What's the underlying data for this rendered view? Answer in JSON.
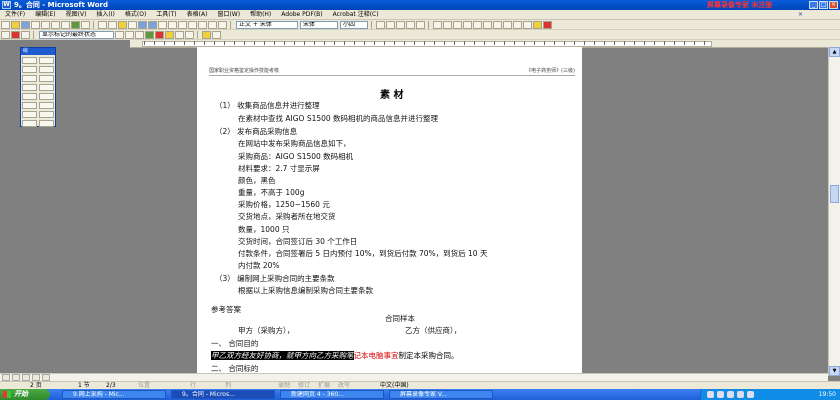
{
  "window": {
    "title": "9。合同 - Microsoft Word",
    "watermark": "屏幕录像专家 未注册"
  },
  "menu": {
    "items": [
      "文件(F)",
      "编辑(E)",
      "视图(V)",
      "插入(I)",
      "格式(O)",
      "工具(T)",
      "表格(A)",
      "窗口(W)",
      "帮助(H)",
      "Adobe PDF(B)",
      "Acrobat 注释(C)"
    ]
  },
  "toolbar": {
    "style": "正文 + 宋体",
    "font": "宋体",
    "size": "小四",
    "markup": "显示标记的最终状态",
    "colors": {
      "highlight": "#ffff00",
      "font_color": "#ff0000"
    }
  },
  "palette": {
    "title": "绘"
  },
  "document": {
    "header_left": "国家职业资格鉴定操作技能考核",
    "header_right": "《电子商务师》(三级)",
    "title": "素  材",
    "lines": [
      "（1）    收集商品信息并进行整理",
      "在素材中查找 AIGO S1500 数码相机的商品信息并进行整理",
      "（2）    发布商品采购信息",
      "在网站中发布采购商品信息如下，",
      "采购商品：AIGO S1500 数码相机",
      "材料要求：2.7 寸显示屏",
      "颜色，黑色",
      "重量，不高于   100g",
      "采购价格，1250~1560 元",
      "交货地点，采购者所在地交货",
      "数量，1000 只",
      "交货时间，合同签订后 30 个工作日",
      "付款条件，合同签署后 5 日内预付 10%，到货后付款 70%，到货后 10 天",
      "内付款 20%",
      "（3）    编制网上采购合同的主要条款",
      "根据以上采购信息编制采购合同主要条款",
      "参考答案",
      "合同样本",
      "甲方（采购方），",
      "乙方（供应商），",
      "一、     合同目的",
      "二、     合同标的"
    ],
    "selected_text": "甲乙双方经友好协商，就甲方向乙方采购笔",
    "red_text": "记本电脑事宜",
    "tail_text": "制定本采购合同。"
  },
  "status": {
    "page": "2 页",
    "section": "1 节",
    "page_count": "2/3",
    "position": "位置",
    "line": "行",
    "column": "列",
    "rec": "录制",
    "trk": "修订",
    "ext": "扩展",
    "ovr": "改写",
    "language": "中文(中国)"
  },
  "taskbar": {
    "start": "开始",
    "tasks": [
      "9.网上采购 - Mic...",
      "9。合同 - Micros...",
      "新建网页 4 - 360...",
      "屏幕录像专家 V..."
    ],
    "clock": "19:50"
  }
}
